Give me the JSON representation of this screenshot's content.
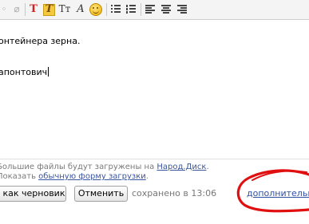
{
  "toolbar": {
    "icons": [
      "unknown-icon",
      "clear-format-icon",
      "text-color-icon",
      "highlight-icon",
      "font-size-icon",
      "font-style-icon",
      "smiley-icon",
      "bullet-list-icon",
      "numbered-list-icon",
      "align-left-icon",
      "align-center-icon",
      "align-right-icon"
    ],
    "text_color_glyph": "T",
    "highlight_glyph": "T",
    "font_size_glyph": "Tт",
    "font_style_glyph": "A",
    "accent_red": "#d42020"
  },
  "editor": {
    "line1": "онтейнера зерна.",
    "line2": "апонтович"
  },
  "upload": {
    "line1_prefix": "Большие файлы будут загружены на ",
    "line1_link": "Народ.Диск",
    "line1_suffix": ".",
    "line2_prefix": "Показать ",
    "line2_link": "обычную форму загрузки",
    "line2_suffix": "."
  },
  "actions": {
    "draft_label": "ь как черновик",
    "cancel_label": "Отменить",
    "saved_status": "сохранено в 13:06",
    "more_link": "дополнительны"
  },
  "annotation": {
    "color": "#e01010"
  }
}
